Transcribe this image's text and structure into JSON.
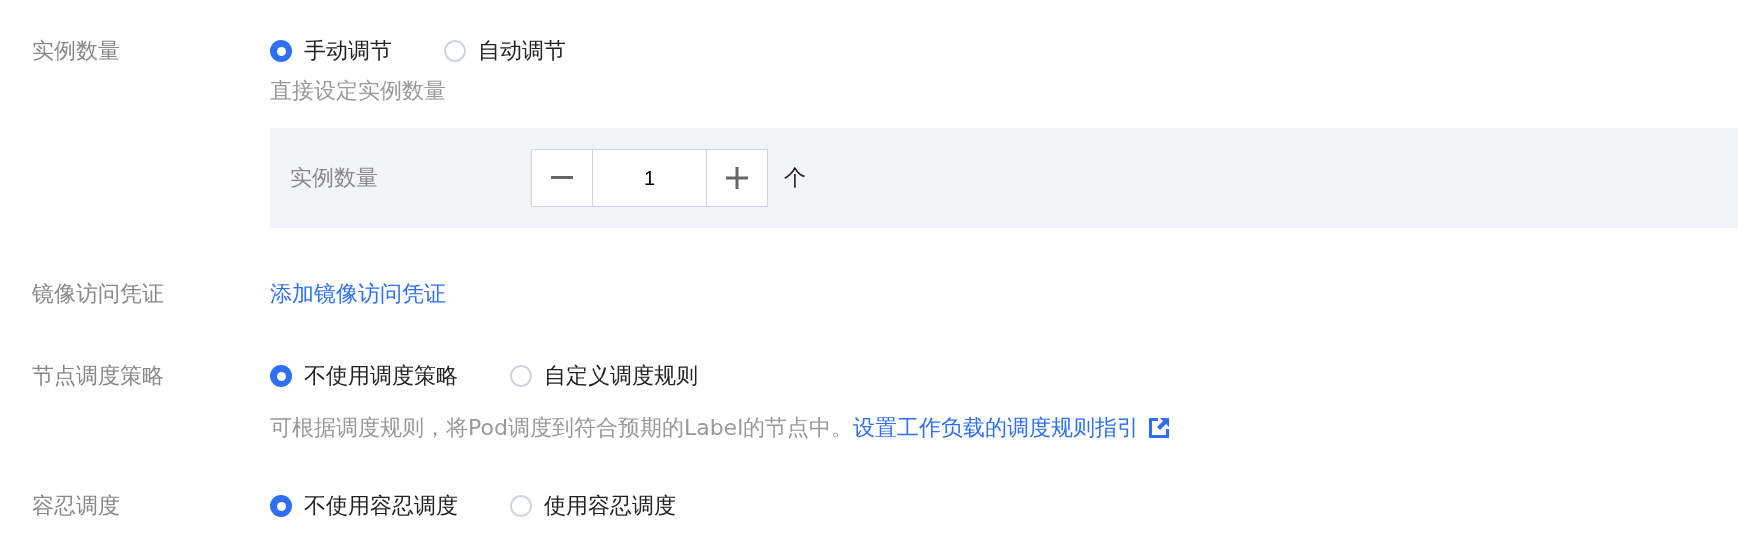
{
  "rows": [
    {
      "kind": "radio",
      "label": "实例数量",
      "options": [
        {
          "label": "手动调节",
          "selected": true
        },
        {
          "label": "自动调节",
          "selected": false
        }
      ],
      "help": {
        "text": "直接设定实例数量"
      },
      "panel": {
        "label": "实例数量",
        "value": "1",
        "unit": "个"
      }
    },
    {
      "kind": "link",
      "label": "镜像访问凭证",
      "link": "添加镜像访问凭证"
    },
    {
      "kind": "radio",
      "label": "节点调度策略",
      "options": [
        {
          "label": "不使用调度策略",
          "selected": true
        },
        {
          "label": "自定义调度规则",
          "selected": false
        }
      ],
      "help": {
        "text": "可根据调度规则，将Pod调度到符合预期的Label的节点中。",
        "link": "设置工作负载的调度规则指引"
      }
    },
    {
      "kind": "radio",
      "label": "容忍调度",
      "options": [
        {
          "label": "不使用容忍调度",
          "selected": true
        },
        {
          "label": "使用容忍调度",
          "selected": false
        }
      ]
    }
  ]
}
